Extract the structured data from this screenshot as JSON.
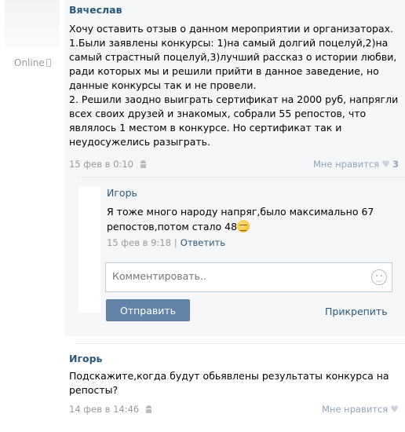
{
  "sidebar": {
    "online_label": "Online"
  },
  "post1": {
    "author": "Вячеслав",
    "text": "Хочу оставить отзыв о данном мероприятии и организаторах.\n1.Были заявлены конкурсы: 1)на самый долгий поцелуй,2)на самый страстный поцелуй,3)лучший рассказ о истории любви, ради которых мы и решили прийти в данное заведение, но данные конкурсы так и не провели.\n2. Решили заодно выиграть сертификат на 2000 руб, напрягли всех своих друзей и знакомых, собрали 55 репостов, что являлось 1 местом в конкурсе. Но сертификат так и неудосужелись разыграть.",
    "date": "15 фев в 0:10",
    "like_label": "Мне нравится",
    "like_count": "3"
  },
  "reply1": {
    "author": "Игорь",
    "text": "Я тоже много народу напряг,было максимально 67 репостов,потом стало 48",
    "date": "15 фев в 9:18",
    "separator": "|",
    "answer_label": "Ответить"
  },
  "comment_form": {
    "placeholder": "Комментировать..",
    "send_label": "Отправить",
    "attach_label": "Прикрепить"
  },
  "post2": {
    "author": "Игорь",
    "text": "Подскажите,когда будут обьявлены результаты конкурса на репосты?",
    "date": "14 фев в 14:46",
    "like_label": "Мне нравится"
  },
  "colors": {
    "link": "#2b587a",
    "button": "#6383a8",
    "post_bg": "#f5f6f8"
  }
}
